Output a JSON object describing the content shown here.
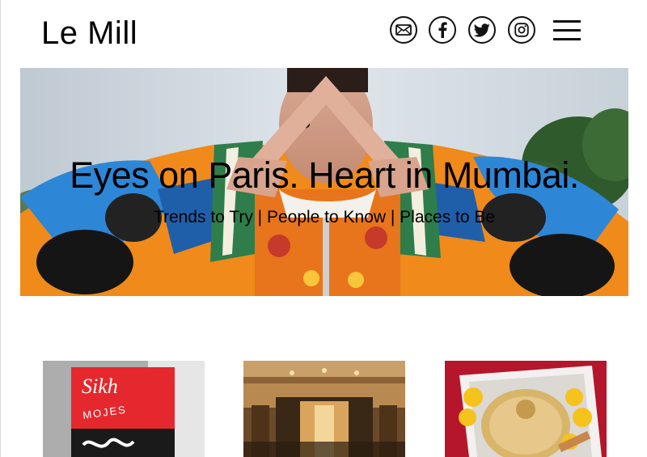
{
  "brand": {
    "name": "Le Mill"
  },
  "header": {
    "social_icons": [
      "mail-icon",
      "facebook-icon",
      "twitter-icon",
      "instagram-icon"
    ],
    "menu_icon": "hamburger-menu-icon"
  },
  "hero": {
    "title": "Eyes on Paris. Heart in Mumbai.",
    "subtitle": "Trends to Try | People to Know | Places to Be"
  },
  "cards": [
    {
      "image_text_1": "Sikh",
      "image_text_2": "MOJES"
    },
    {
      "image_desc": "interior"
    },
    {
      "image_desc": "tray"
    }
  ],
  "colors": {
    "text": "#111111",
    "card1_red": "#e5282d",
    "card3_red": "#b5162b",
    "hero_blue": "#2e86d6",
    "hero_orange": "#f08a1a"
  }
}
